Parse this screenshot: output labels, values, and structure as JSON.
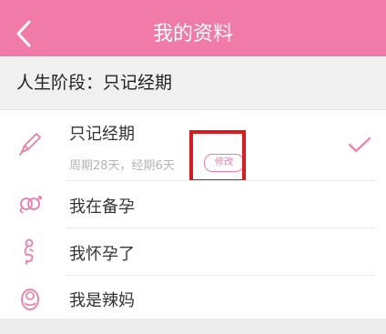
{
  "header": {
    "title": "我的资料",
    "back_icon": "chevron-left-icon",
    "color": "#f07aa8"
  },
  "section": {
    "label": "人生阶段：只记经期"
  },
  "options": [
    {
      "label": "只记经期",
      "icon": "pen-icon",
      "selected": true,
      "subtitle": "周期28天，经期6天",
      "edit_label": "修改"
    },
    {
      "label": "我在备孕",
      "icon": "gender-symbols-icon"
    },
    {
      "label": "我怀孕了",
      "icon": "pregnant-icon"
    },
    {
      "label": "我是辣妈",
      "icon": "baby-icon"
    }
  ]
}
